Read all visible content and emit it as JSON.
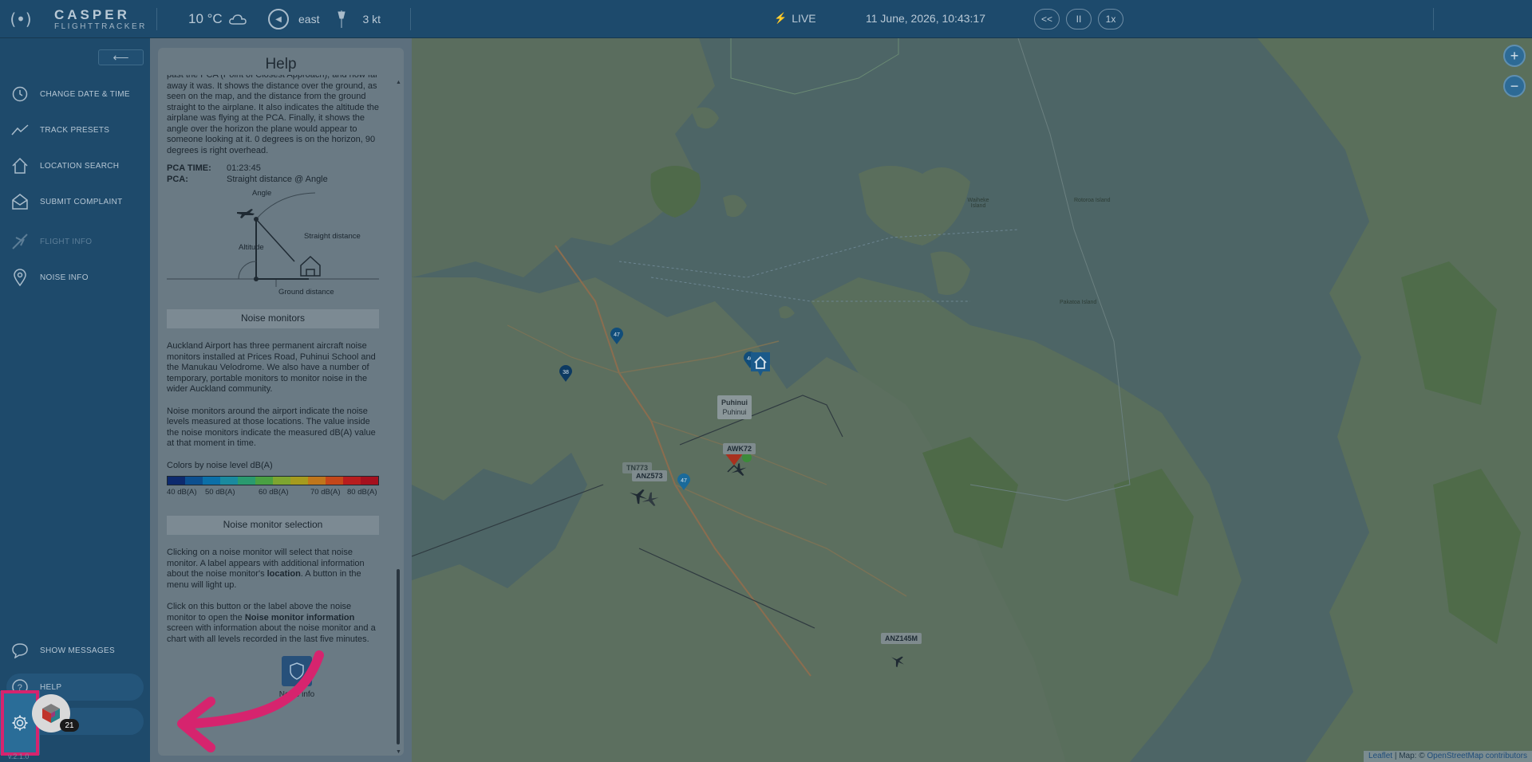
{
  "app": {
    "logo_mark": "(•)",
    "name": "CASPER",
    "subtitle": "FLIGHTTRACKER",
    "version": "v.2.1.0"
  },
  "topbar": {
    "temperature": "10 °C",
    "weather_icon": "cloud-icon",
    "wind_direction": "east",
    "wind_speed": "3 kt",
    "live_label": "LIVE",
    "datetime": "11 June, 2026, 10:43:17",
    "playback": {
      "rewind": "<<",
      "pause": "II",
      "speed": "1x"
    }
  },
  "sidebar": {
    "collapse_icon": "arrow-left-icon",
    "items": [
      {
        "label": "CHANGE DATE & TIME",
        "icon": "clock-icon",
        "enabled": true
      },
      {
        "label": "TRACK PRESETS",
        "icon": "trend-icon",
        "enabled": true
      },
      {
        "label": "LOCATION SEARCH",
        "icon": "home-icon",
        "enabled": true
      },
      {
        "label": "SUBMIT COMPLAINT",
        "icon": "envelope-icon",
        "enabled": true
      },
      {
        "label": "FLIGHT INFO",
        "icon": "plane-icon",
        "enabled": false
      },
      {
        "label": "NOISE INFO",
        "icon": "location-pin-icon",
        "enabled": true
      }
    ],
    "bottom": {
      "messages_label": "SHOW MESSAGES",
      "help_label": "HELP",
      "message_count": "21"
    }
  },
  "help": {
    "title": "Help",
    "intro": "past the PCA (Point of Closest Approach), and how far away it was. It shows the distance over the ground, as seen on the map, and the distance from the ground straight to the airplane. It also indicates the altitude the airplane was flying at the PCA. Finally, it shows the angle over the horizon the plane would appear to someone looking at it. 0 degrees is on the horizon, 90 degrees is right overhead.",
    "pca_time_key": "PCA TIME:",
    "pca_time_val": "01:23:45",
    "pca_key": "PCA:",
    "pca_val": "Straight distance @ Angle",
    "diagram": {
      "angle": "Angle",
      "altitude": "Altitude",
      "straight": "Straight distance",
      "ground": "Ground distance"
    },
    "section_monitors": "Noise monitors",
    "monitors_p1": "Auckland Airport has three permanent aircraft noise monitors installed at Prices Road, Puhinui School and the Manukau Velodrome. We also have a number of temporary, portable monitors to monitor noise in the wider Auckland community.",
    "monitors_p2": "Noise monitors around the airport indicate the noise levels measured at those locations. The value inside the noise monitors indicate the measured dB(A) value at that moment in time.",
    "colorbar_title": "Colors by noise level dB(A)",
    "colorbar_labels": [
      "40 dB(A)",
      "50 dB(A)",
      "60 dB(A)",
      "70 dB(A)",
      "80 dB(A)"
    ],
    "colorbar_colors": [
      "#0d2a6e",
      "#0c4f8f",
      "#0b6fa8",
      "#1a8a9f",
      "#2a9a6f",
      "#4aa042",
      "#7ea530",
      "#a69b1e",
      "#c0761b",
      "#c4471a",
      "#b81d1e",
      "#a5101e"
    ],
    "section_selection": "Noise monitor selection",
    "selection_p1_a": "Clicking on a noise monitor will select that noise monitor. A label appears with additional information about the noise monitor's ",
    "selection_p1_b": "location",
    "selection_p1_c": ". A button in the menu will light up.",
    "selection_p2_a": "Click on this button or the label above the noise monitor to open the ",
    "selection_p2_b": "Noise monitor information",
    "selection_p2_c": " screen with information about the noise monitor and a chart with all levels recorded in the last five minutes.",
    "noise_info_label": "Noise info"
  },
  "map": {
    "flights": [
      {
        "callsign": "AWK72"
      },
      {
        "callsign": "ANZ573"
      },
      {
        "callsign": "TN773"
      },
      {
        "callsign": "ANZ145M"
      }
    ],
    "monitors": [
      {
        "value": "47"
      },
      {
        "value": "38"
      },
      {
        "value": "46"
      },
      {
        "value": "47"
      }
    ],
    "location_label_title": "Puhinui",
    "location_label_sub": "Puhinui",
    "place_names": [
      "Waiheke Island",
      "Pakatoa Island",
      "Rotoroa Island"
    ],
    "attribution_a": "Leaflet",
    "attribution_b": " | Map: © ",
    "attribution_c": "OpenStreetMap contributors",
    "zoom_in": "+",
    "zoom_out": "−"
  },
  "colors": {
    "topbar": "#1d4a6c",
    "sidebar": "#1e4a6b",
    "accent_pink": "#d6246e",
    "map_water": "#4e6668",
    "map_land": "#5b6f5f"
  }
}
